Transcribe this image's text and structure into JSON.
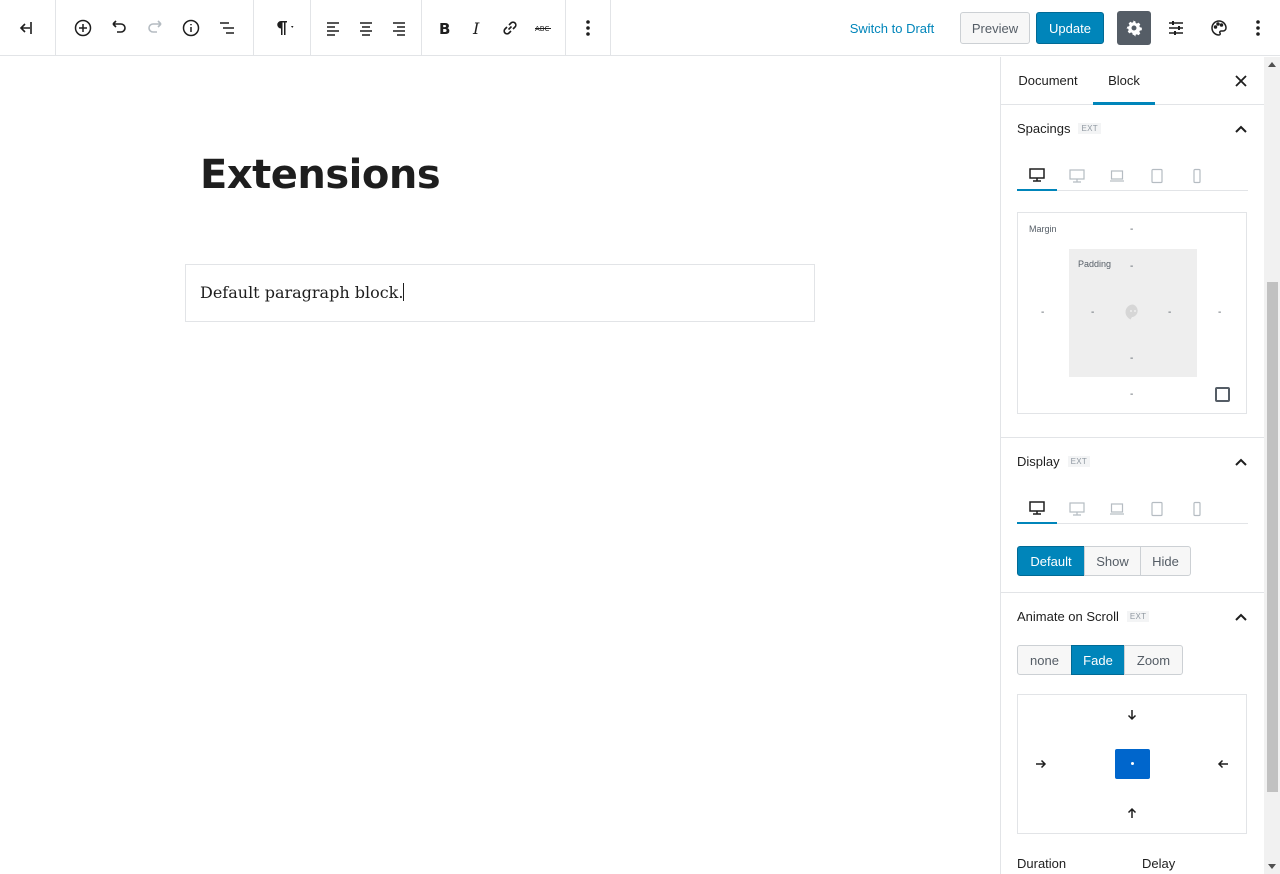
{
  "toolbar": {
    "switch_draft": "Switch to Draft",
    "preview": "Preview",
    "update": "Update"
  },
  "editor": {
    "title": "Extensions",
    "paragraph": "Default paragraph block."
  },
  "sidebar": {
    "tabs": [
      "Document",
      "Block"
    ],
    "active_tab": "Block",
    "spacings": {
      "title": "Spacings",
      "badge": "EXT",
      "margin_label": "Margin",
      "padding_label": "Padding",
      "empty": "-"
    },
    "display": {
      "title": "Display",
      "badge": "EXT",
      "options": [
        "Default",
        "Show",
        "Hide"
      ],
      "selected": "Default"
    },
    "animate": {
      "title": "Animate on Scroll",
      "badge": "EXT",
      "options": [
        "none",
        "Fade",
        "Zoom"
      ],
      "selected": "Fade",
      "duration_label": "Duration",
      "delay_label": "Delay"
    }
  },
  "colors": {
    "accent": "#0085ba",
    "anchor_active": "#0066cc",
    "gear_bg": "#555d66"
  }
}
